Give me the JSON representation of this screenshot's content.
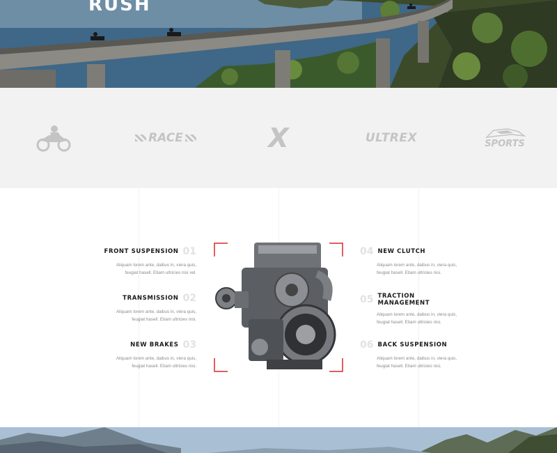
{
  "hero": {
    "title": "RUSH"
  },
  "brand_logos": [
    {
      "name": "moto-rider-logo",
      "text": ""
    },
    {
      "name": "race-logo",
      "text": "RACE"
    },
    {
      "name": "x-logo",
      "text": "X"
    },
    {
      "name": "ultrex-logo",
      "text": "ULTREX"
    },
    {
      "name": "bike-sports-logo",
      "text": "SPORTS"
    }
  ],
  "features": {
    "left": [
      {
        "num": "01",
        "title": "FRONT SUSPENSION",
        "line1": "Aliquam lorem ante, daibus in, viera quis,",
        "line2": "feugiat hasell. Etiam ultricies nisi vel."
      },
      {
        "num": "02",
        "title": "TRANSMISSION",
        "line1": "Aliquam lorem ante, daibus in, viera quis,",
        "line2": "feugiat hasell. Etiam ultricies nisi."
      },
      {
        "num": "03",
        "title": "NEW BRAKES",
        "line1": "Aliquam lorem ante, daibus in, viera quis,",
        "line2": "feugiat hasell. Etiam ultricies nisi."
      }
    ],
    "right": [
      {
        "num": "04",
        "title": "NEW CLUTCH",
        "line1": "Aliquam lorem ante, daibus in, viera quis,",
        "line2": "feugiat hasell. Etiam ultricies nisi."
      },
      {
        "num": "05",
        "title": "TRACTION MANAGEMENT",
        "line1": "Aliquam lorem ante, daibus in, viera quis,",
        "line2": "feugiat hasell. Etiam ultricies nisi."
      },
      {
        "num": "06",
        "title": "BACK SUSPENSION",
        "line1": "Aliquam lorem ante, daibus in, viera quis,",
        "line2": "feugiat hasell. Etiam ultricies nisi."
      }
    ]
  },
  "colors": {
    "accent": "#d8292b",
    "logo_gray": "#c4c4c4",
    "strip_bg": "#f2f2f2",
    "number_gray": "#e2e2e2"
  }
}
